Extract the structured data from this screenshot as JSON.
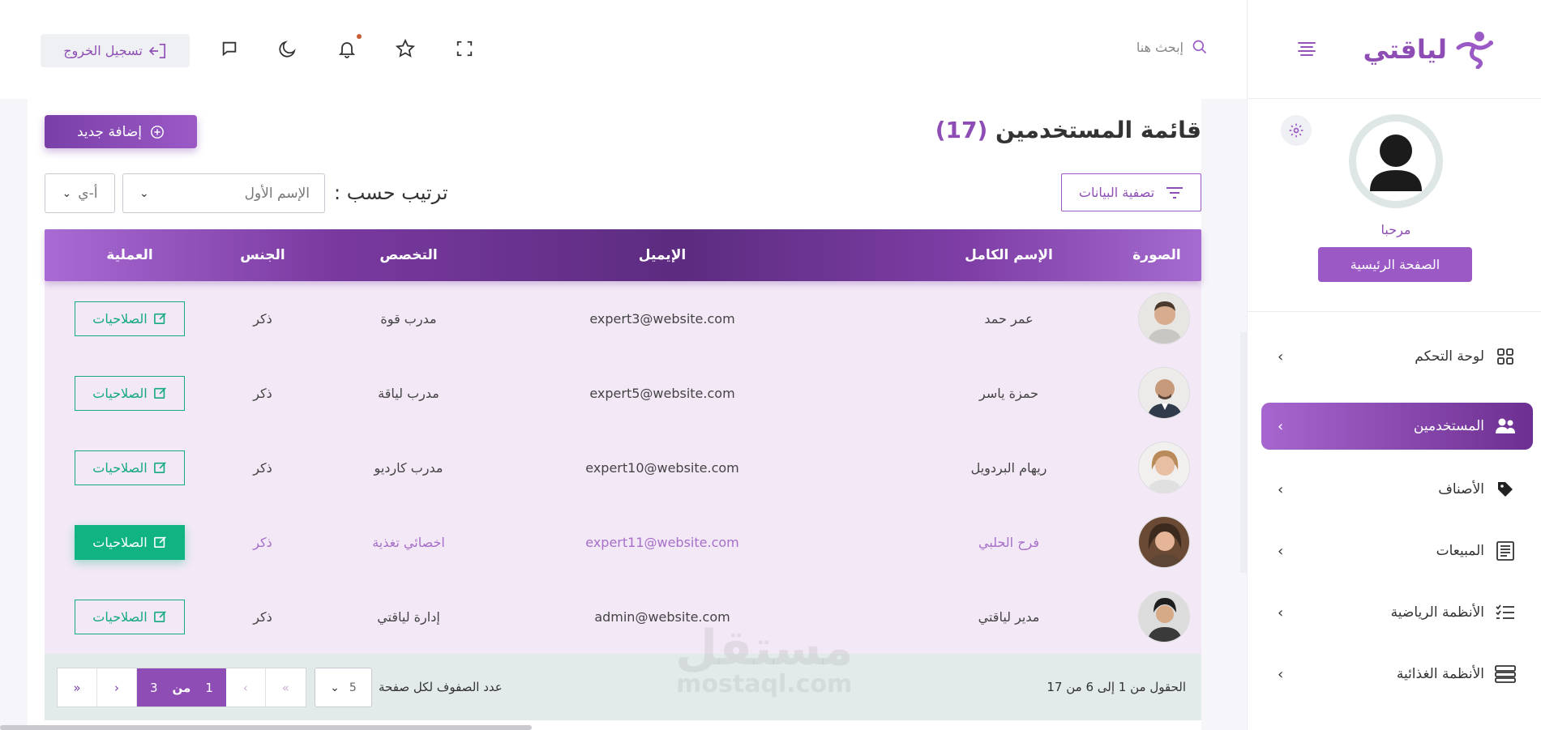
{
  "app": {
    "logo_text": "لياقتي"
  },
  "topbar": {
    "search_placeholder": "إبحث هنا",
    "logout_label": "تسجيل الخروج",
    "accent": "#8e4db4"
  },
  "sidebar": {
    "welcome": "مرحبا",
    "home_button": "الصفحة الرئيسية",
    "items": [
      {
        "label": "لوحة التحكم",
        "icon": "grid-icon",
        "active": false
      },
      {
        "label": "المستخدمين",
        "icon": "users-icon",
        "active": true
      },
      {
        "label": "الأصناف",
        "icon": "tag-icon",
        "active": false
      },
      {
        "label": "المبيعات",
        "icon": "receipt-icon",
        "active": false
      },
      {
        "label": "الأنظمة الرياضية",
        "icon": "list-check-icon",
        "active": false
      },
      {
        "label": "الأنظمة الغذائية",
        "icon": "food-menu-icon",
        "active": false
      }
    ]
  },
  "main": {
    "title": "قائمة المستخدمين",
    "count": "(17)",
    "add_button": "إضافة جديد",
    "filter_button": "تصفية البيانات",
    "sort_label": "ترتيب حسب :",
    "sort_value": "الإسم الأول",
    "sort_direction": "أ-ي"
  },
  "table": {
    "headers": {
      "photo": "الصورة",
      "full_name": "الإسم الكامل",
      "email": "الإيميل",
      "specialty": "التخصص",
      "gender": "الجنس",
      "action": "العملية"
    },
    "rows": [
      {
        "name": "عمر حمد",
        "email": "expert3@website.com",
        "specialty": "مدرب قوة",
        "gender": "ذكر",
        "action": "الصلاحيات",
        "highlight": false
      },
      {
        "name": "حمزة ياسر",
        "email": "expert5@website.com",
        "specialty": "مدرب لياقة",
        "gender": "ذكر",
        "action": "الصلاحيات",
        "highlight": false
      },
      {
        "name": "ريهام البردويل",
        "email": "expert10@website.com",
        "specialty": "مدرب كارديو",
        "gender": "ذكر",
        "action": "الصلاحيات",
        "highlight": false
      },
      {
        "name": "فرح الحلبي",
        "email": "expert11@website.com",
        "specialty": "اخصائي تغذية",
        "gender": "ذكر",
        "action": "الصلاحيات",
        "highlight": true
      },
      {
        "name": "مدير لياقتي",
        "email": "admin@website.com",
        "specialty": "إدارة لياقتي",
        "gender": "ذكر",
        "action": "الصلاحيات",
        "highlight": false
      }
    ]
  },
  "footer": {
    "records_info": "الحقول من 1 إلى 6 من 17",
    "rows_per_page_label": "عدد الصفوف لكل صفحة",
    "rows_per_page": "5",
    "current_page": "1",
    "of_label": "من",
    "total_pages": "3"
  },
  "watermark": {
    "text": "مستقل",
    "sub": "mostaql.com"
  }
}
